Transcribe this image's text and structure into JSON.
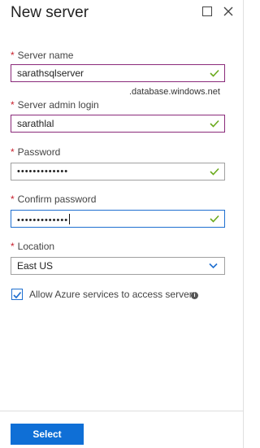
{
  "header": {
    "title": "New server",
    "maximize_icon": "maximize-icon",
    "close_icon": "close-icon"
  },
  "form": {
    "required_marker": "*",
    "server_name": {
      "label": "Server name",
      "value": "sarathsqlserver",
      "suffix": ".database.windows.net",
      "valid": true
    },
    "admin_login": {
      "label": "Server admin login",
      "value": "sarathlal",
      "valid": true
    },
    "password": {
      "label": "Password",
      "value": "•••••••••••••",
      "valid": true
    },
    "confirm_password": {
      "label": "Confirm password",
      "value": "•••••••••••••",
      "valid": true
    },
    "location": {
      "label": "Location",
      "value": "East US"
    },
    "allow_azure": {
      "label": "Allow Azure services to access server",
      "checked": true,
      "info_icon": "info-icon"
    }
  },
  "footer": {
    "select_label": "Select"
  },
  "colors": {
    "accent": "#0f6fd6",
    "required": "#c8202d",
    "valid_check": "#6aaa1c"
  }
}
